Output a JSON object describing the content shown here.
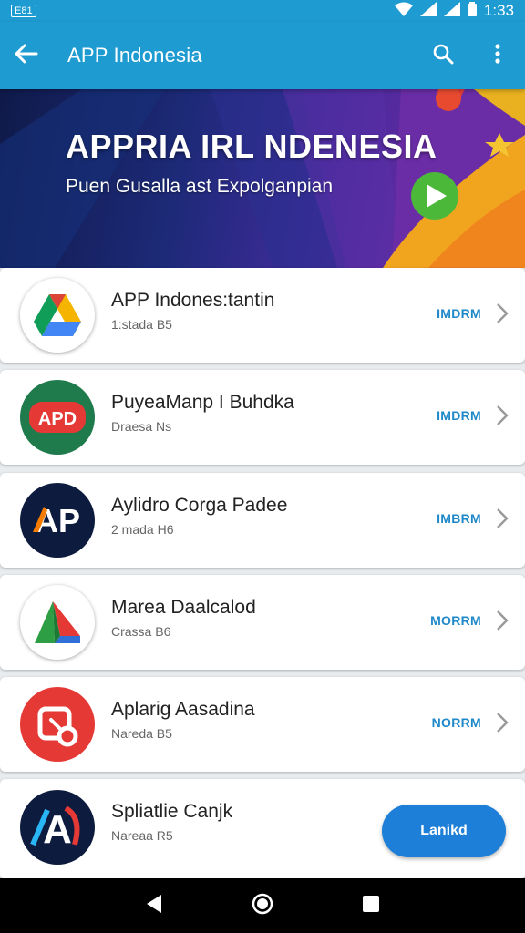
{
  "status_bar": {
    "left_badge": "E81",
    "time": "1:33"
  },
  "app_bar": {
    "title": "APP Indonesia",
    "icons": [
      "back-arrow-icon",
      "search-icon",
      "more-vert-icon"
    ]
  },
  "banner": {
    "title": "APPRIA IRL NDENESIA",
    "subtitle": "Puen Gusalla ast Expolganpian"
  },
  "apps": [
    {
      "name": "APP Indones:tantin",
      "meta": "1:stada B5",
      "action": "IMDRM",
      "icon": "drive-triangle-icon"
    },
    {
      "name": "PuyeaManp I Buhdka",
      "meta": "Draesa Ns",
      "action": "IMDRM",
      "icon": "apd-logo-icon",
      "icon_text": "APD"
    },
    {
      "name": "Aylidro Corga Padee",
      "meta": "2 mada H6",
      "action": "IMBRM",
      "icon": "ap-logo-icon",
      "icon_text": "AP"
    },
    {
      "name": "Marea Daalcalod",
      "meta": "Crassa B6",
      "action": "MORRM",
      "icon": "green-triangle-icon"
    },
    {
      "name": "Aplarig Aasadina",
      "meta": "Nareda B5",
      "action": "NORRM",
      "icon": "edit-circle-icon"
    },
    {
      "name": "Spliatlie Canjk",
      "meta": "Nareaa R5",
      "action_button": "Lanikd",
      "icon": "a-logo-icon",
      "icon_text": "A"
    }
  ],
  "colors": {
    "primary": "#1e9bd0",
    "accent_link": "#1e88c8",
    "install_button": "#1d7fd8"
  }
}
